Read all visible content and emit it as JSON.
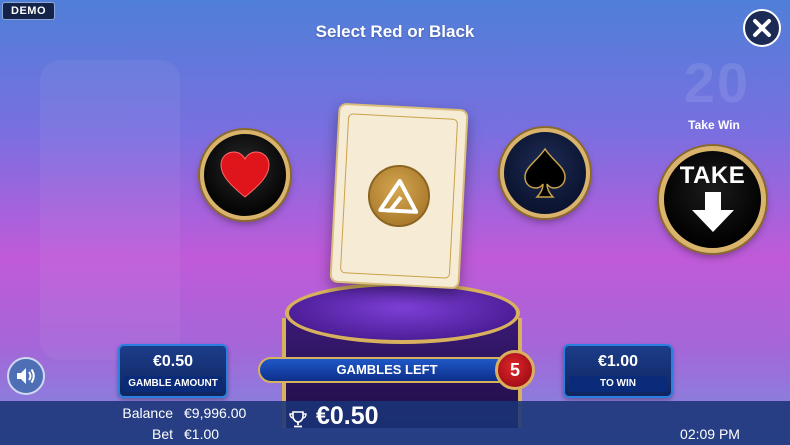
{
  "badge": "DEMO",
  "title": "Select Red or Black",
  "choices": {
    "red": {
      "icon": "heart-icon",
      "color": "#e0141b"
    },
    "black": {
      "icon": "spade-icon",
      "color": "#000000"
    }
  },
  "take_win": {
    "label": "Take Win",
    "button_text": "TAKE"
  },
  "gamble_amount": {
    "value": "€0.50",
    "label": "GAMBLE AMOUNT"
  },
  "gambles_left": {
    "label": "GAMBLES LEFT",
    "count": "5"
  },
  "to_win": {
    "value": "€1.00",
    "label": "TO WIN"
  },
  "footer": {
    "balance_label": "Balance",
    "balance_value": "€9,996.00",
    "bet_label": "Bet",
    "bet_value": "€1.00",
    "win_value": "€0.50",
    "clock": "02:09 PM"
  },
  "colors": {
    "gold": "#d7b15d",
    "panel_blue": "#1c3d8a",
    "accent_red": "#e0252b"
  }
}
